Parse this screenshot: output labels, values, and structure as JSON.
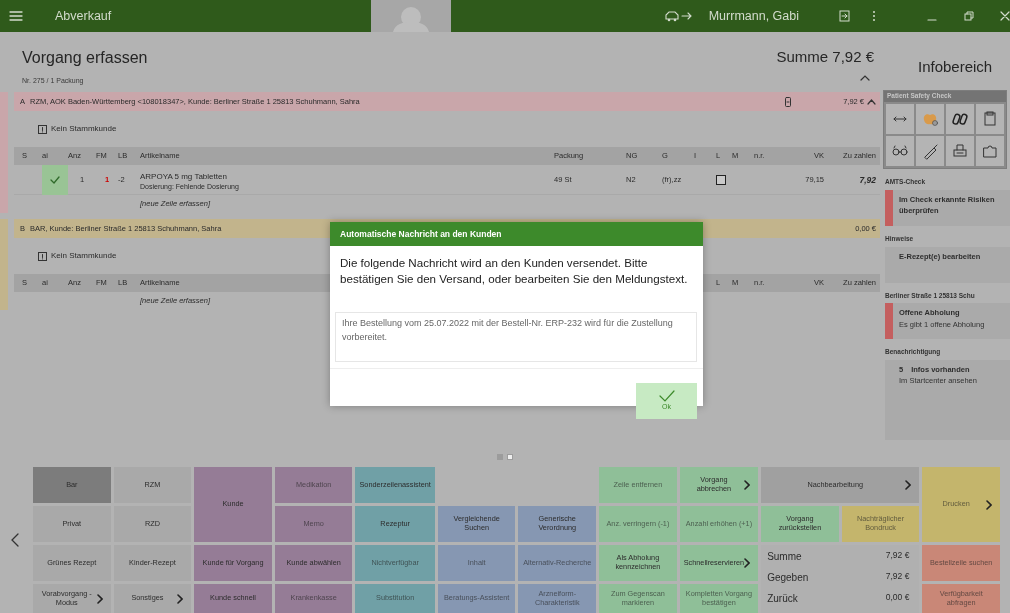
{
  "topbar": {
    "title": "Abverkauf",
    "user": "Murrmann, Gabi"
  },
  "header": {
    "title": "Vorgang erfassen",
    "subtitle": "Nr. 275 / 1 Packung",
    "total": "Summe 7,92 €",
    "expanded": true
  },
  "sections": [
    {
      "letter": "A",
      "title": "RZM, AOK Baden-Württemberg <108018347>, Kunde: Berliner Straße 1 25813 Schuhmann, Sahra",
      "amount": "7,92 €",
      "color": "#c9a6aa",
      "device_icon": true,
      "expanded": true,
      "customer_note": "Kein Stammkunde",
      "columns": [
        "S",
        "ai",
        "Anz",
        "FM",
        "LB",
        "Artikelname",
        "Packung",
        "NG",
        "G",
        "I",
        "L",
        "M",
        "n.r.",
        "VK",
        "Zu zahlen"
      ],
      "rows": [
        {
          "kind": "item",
          "ai_checked": true,
          "anz": "1",
          "fm": "1",
          "fm_warning": true,
          "lb": "-2",
          "name": "ARPOYA 5 mg Tabletten",
          "detail": "Dosierung: Fehlende Dosierung",
          "packung": "49 St",
          "ng": "N2",
          "g": "(fr),zz",
          "l_checked": false,
          "vk": "79,15",
          "zu_zahlen": "7,92"
        },
        {
          "kind": "new",
          "name": "[neue Zeile erfassen]"
        }
      ]
    },
    {
      "letter": "B",
      "title": "BAR, Kunde: Berliner Straße 1 25813 Schuhmann, Sahra",
      "amount": "0,00 €",
      "color": "#c2b48c",
      "customer_note": "Kein Stammkunde",
      "columns": [
        "S",
        "ai",
        "Anz",
        "FM",
        "LB",
        "Artikelname",
        "L",
        "M",
        "n.r.",
        "VK",
        "Zu zahlen"
      ],
      "rows": [
        {
          "kind": "new",
          "name": "[neue Zeile erfassen]"
        }
      ]
    }
  ],
  "info": {
    "title": "Infobereich",
    "safety_check": {
      "title": "Patient Safety Check"
    },
    "groups": [
      {
        "label": "AMTS-Check",
        "card": {
          "title": "Im Check erkannte Risiken überprüfen",
          "alert": true
        }
      },
      {
        "label": "Hinweise",
        "card": {
          "title": "E-Rezept(e) bearbeiten",
          "alert": false
        }
      },
      {
        "label": "Berliner Straße 1 25813 Schu",
        "card": {
          "title": "Offene Abholung",
          "text": "Es gibt 1 offene Abholung",
          "alert": true
        }
      },
      {
        "label": "Benachrichtigung",
        "card": {
          "count": "5",
          "title": "Infos vorhanden",
          "text": "Im Startcenter ansehen",
          "alert": false
        }
      }
    ]
  },
  "dialog": {
    "title": "Automatische Nachricht an den Kunden",
    "message": "Die folgende Nachricht wird an den Kunden versendet. Bitte bestätigen Sie den Versand, oder bearbeiten Sie den Meldungstext.",
    "text": "Ihre Bestellung vom 25.07.2022 mit der Bestell-Nr. ERP-232 wird für die Zustellung vorbereitet.",
    "ok": "Ok"
  },
  "pages": [
    {
      "selected": true
    },
    {
      "selected": false
    }
  ],
  "keys": [
    {
      "kind": "button",
      "label": "Bar",
      "color": "#7c7c7c",
      "disabled": false,
      "submenu": false
    },
    {
      "kind": "button",
      "label": "RZM",
      "color": "#a9a9a9",
      "disabled": false,
      "submenu": false
    },
    {
      "kind": "button",
      "label": "Kunde",
      "color": "#957c96",
      "disabled": false,
      "submenu": false
    },
    {
      "kind": "button",
      "label": "Medikation",
      "color": "#957c96",
      "disabled": true,
      "submenu": false
    },
    {
      "kind": "button",
      "label": "Sonderzeilenassistent",
      "color": "#70a0a6",
      "disabled": false,
      "submenu": false
    },
    {
      "kind": "button",
      "label": "Zeile entfernen",
      "color": "#8fbf98",
      "disabled": true,
      "submenu": false
    },
    {
      "kind": "button",
      "label": "Vorgang abbrechen",
      "color": "#8fbf98",
      "disabled": false,
      "submenu": true
    },
    {
      "kind": "button",
      "label": "Nachbearbeitung",
      "color": "#a0a0a0",
      "disabled": false,
      "submenu": true
    },
    {
      "kind": "button",
      "label": "Drucken",
      "color": "#c4b56c",
      "disabled": true,
      "submenu": true
    },
    {
      "kind": "button",
      "label": "Privat",
      "color": "#a9a9a9",
      "disabled": false,
      "submenu": false
    },
    {
      "kind": "button",
      "label": "RZD",
      "color": "#a9a9a9",
      "disabled": false,
      "submenu": false
    },
    {
      "kind": "button",
      "label": "Memo",
      "color": "#957c96",
      "disabled": true,
      "submenu": false
    },
    {
      "kind": "button",
      "label": "Rezeptur",
      "color": "#70a0a6",
      "disabled": false,
      "submenu": false
    },
    {
      "kind": "button",
      "label": "Vergleichende Suchen",
      "color": "#8697b2",
      "disabled": false,
      "submenu": false
    },
    {
      "kind": "button",
      "label": "Generische Verordnung",
      "color": "#8697b2",
      "disabled": false,
      "submenu": false
    },
    {
      "kind": "button",
      "label": "Anz. verringern (-1)",
      "color": "#8fbf98",
      "disabled": true,
      "submenu": false
    },
    {
      "kind": "button",
      "label": "Anzahl erhöhen (+1)",
      "color": "#8fbf98",
      "disabled": true,
      "submenu": false
    },
    {
      "kind": "button",
      "label": "Vorgang zurückstellen",
      "color": "#8fbf98",
      "disabled": false,
      "submenu": false
    },
    {
      "kind": "button",
      "label": "Nachträglicher Bondruck",
      "color": "#c4b56c",
      "disabled": true,
      "submenu": false
    },
    {
      "kind": "button",
      "label": "Grünes Rezept",
      "color": "#a9a9a9",
      "disabled": false,
      "submenu": false
    },
    {
      "kind": "button",
      "label": "Kinder-Rezept",
      "color": "#a9a9a9",
      "disabled": false,
      "submenu": false
    },
    {
      "kind": "button",
      "label": "Kunde für Vorgang",
      "color": "#957c96",
      "disabled": false,
      "submenu": false
    },
    {
      "kind": "button",
      "label": "Kunde abwählen",
      "color": "#957c96",
      "disabled": false,
      "submenu": false
    },
    {
      "kind": "button",
      "label": "Nichtverfügbar",
      "color": "#70a0a6",
      "disabled": true,
      "submenu": false
    },
    {
      "kind": "button",
      "label": "Inhalt",
      "color": "#8697b2",
      "disabled": true,
      "submenu": false
    },
    {
      "kind": "button",
      "label": "Alternativ-Recherche",
      "color": "#8697b2",
      "disabled": true,
      "submenu": false
    },
    {
      "kind": "button",
      "label": "Als Abholung kennzeichnen",
      "color": "#8fbf98",
      "disabled": false,
      "submenu": false
    },
    {
      "kind": "button",
      "label": "Schnellreservieren",
      "color": "#8fbf98",
      "disabled": false,
      "submenu": true
    },
    {
      "kind": "totals",
      "rows": [
        {
          "label": "Summe",
          "value": "7,92 €"
        },
        {
          "label": "Gegeben",
          "value": "7,92 €"
        },
        {
          "label": "Zurück",
          "value": "0,00 €"
        }
      ]
    },
    {
      "kind": "button",
      "label": "Bestellzeile suchen",
      "color": "#c98777",
      "disabled": true,
      "submenu": false
    },
    {
      "kind": "button",
      "label": "Vorabvorgang - Modus",
      "color": "#a9a9a9",
      "disabled": false,
      "submenu": true
    },
    {
      "kind": "button",
      "label": "Sonstiges",
      "color": "#a9a9a9",
      "disabled": false,
      "submenu": true
    },
    {
      "kind": "button",
      "label": "Kunde schnell",
      "color": "#957c96",
      "disabled": false,
      "submenu": false
    },
    {
      "kind": "button",
      "label": "Krankenkasse",
      "color": "#957c96",
      "disabled": true,
      "submenu": false
    },
    {
      "kind": "button",
      "label": "Substitution",
      "color": "#70a0a6",
      "disabled": true,
      "submenu": false
    },
    {
      "kind": "button",
      "label": "Beratungs-Assistent",
      "color": "#8697b2",
      "disabled": true,
      "submenu": false
    },
    {
      "kind": "button",
      "label": "Arzneiform-Charakteristik",
      "color": "#8697b2",
      "disabled": true,
      "submenu": false
    },
    {
      "kind": "button",
      "label": "Zum Gegenscan markieren",
      "color": "#8fbf98",
      "disabled": true,
      "submenu": false
    },
    {
      "kind": "button",
      "label": "Kompletten Vorgang bestätigen",
      "color": "#8fbf98",
      "disabled": true,
      "submenu": false
    },
    {
      "kind": "button",
      "label": "Verfügbarkeit abfragen",
      "color": "#c98777",
      "disabled": true,
      "submenu": false
    }
  ]
}
